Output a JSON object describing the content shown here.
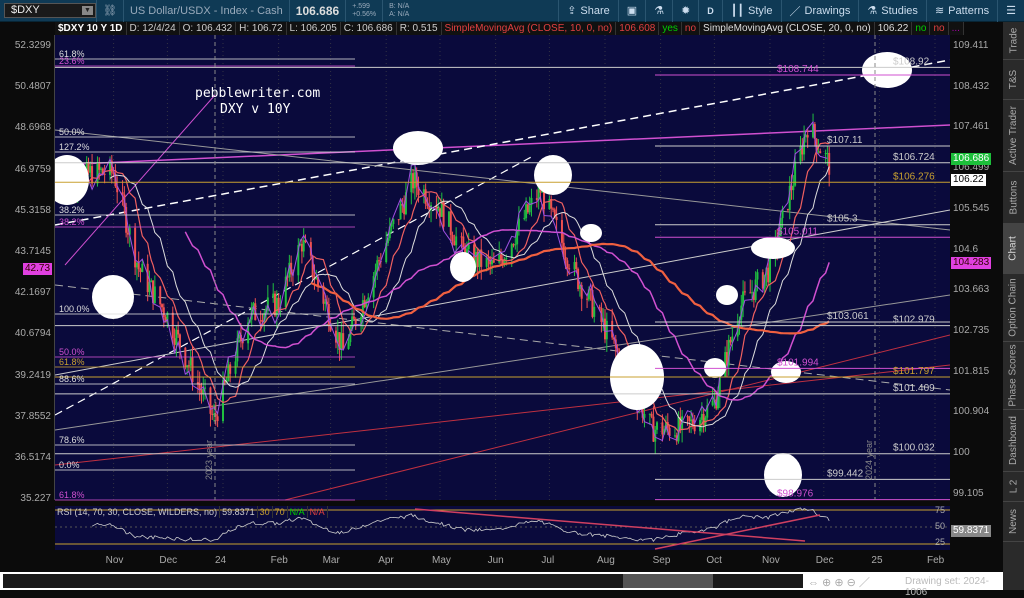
{
  "topbar": {
    "symbol": "$DXY",
    "description": "US Dollar/USDX - Index - Cash",
    "last": "106.686",
    "change": "+.599",
    "change_pct": "+0.56%",
    "bid": "B: N/A",
    "ask": "A: N/A",
    "buttons": [
      {
        "label": "Share",
        "icon": "share-icon"
      },
      {
        "label": "",
        "icon": "screenshot-icon"
      },
      {
        "label": "",
        "icon": "flask-icon"
      },
      {
        "label": "",
        "icon": "gear-icon"
      },
      {
        "label": "D",
        "icon": ""
      },
      {
        "label": "Style",
        "icon": "candle-icon"
      },
      {
        "label": "Drawings",
        "icon": "pencil-icon"
      },
      {
        "label": "Studies",
        "icon": "flask-icon"
      },
      {
        "label": "Patterns",
        "icon": "patterns-icon"
      },
      {
        "label": "",
        "icon": "menu-icon"
      }
    ]
  },
  "infobar": {
    "title": "$DXY 10 Y 1D",
    "date": "D: 12/4/24",
    "open": "O: 106.432",
    "high": "H: 106.72",
    "low": "L: 106.205",
    "close": "C: 106.686",
    "range": "R: 0.515",
    "sma1": "SimpleMovingAvg (CLOSE, 10, 0, no)",
    "sma1_val": "106.608",
    "sma1_a": "yes",
    "sma1_b": "no",
    "sma2": "SimpleMovingAvg (CLOSE, 20, 0, no)",
    "sma2_val": "106.22",
    "sma2_a": "no",
    "sma2_b": "no",
    "more": "..."
  },
  "watermark": {
    "site": "pebblewriter.com",
    "subtitle": "DXY v 10Y"
  },
  "left_axis": [
    "52.3299",
    "50.4807",
    "48.6968",
    "46.9759",
    "45.3158",
    "43.7145",
    "42.1697",
    "40.6794",
    "39.2419",
    "37.8552",
    "36.5174",
    "35.227"
  ],
  "left_badge": "42.73",
  "right_axis": [
    "109.411",
    "108.432",
    "107.461",
    "106.499",
    "105.545",
    "104.6",
    "103.663",
    "102.735",
    "101.815",
    "100.904",
    "100",
    "99.105"
  ],
  "right_badges": {
    "last": "106.686",
    "sma20": "106.22",
    "tnx": "104.283"
  },
  "fib_labels": [
    {
      "t": "61.8%",
      "c": "#ddd"
    },
    {
      "t": "23.6%",
      "c": "#d050d0"
    },
    {
      "t": "50.0%",
      "c": "#ddd"
    },
    {
      "t": "127.2%",
      "c": "#ddd"
    },
    {
      "t": "38.2%",
      "c": "#ddd"
    },
    {
      "t": "38.2%",
      "c": "#d050d0"
    },
    {
      "t": "100.0%",
      "c": "#ddd"
    },
    {
      "t": "50.0%",
      "c": "#d050d0"
    },
    {
      "t": "61.8%",
      "c": "#c8a030"
    },
    {
      "t": "88.6%",
      "c": "#ddd"
    },
    {
      "t": "78.6%",
      "c": "#ddd"
    },
    {
      "t": "0.0%",
      "c": "#ddd"
    },
    {
      "t": "61.8%",
      "c": "#d050d0"
    }
  ],
  "levels": [
    {
      "label": "$108.92",
      "price": 108.92,
      "color": "#cccccc"
    },
    {
      "label": "$108.744",
      "price": 108.744,
      "color": "#d050d0"
    },
    {
      "label": "$107.11",
      "price": 107.11,
      "color": "#cccccc"
    },
    {
      "label": "$106.724",
      "price": 106.724,
      "color": "#cccccc"
    },
    {
      "label": "$106.276",
      "price": 106.276,
      "color": "#c8a030"
    },
    {
      "label": "$105.3",
      "price": 105.3,
      "color": "#cccccc"
    },
    {
      "label": "$105.011",
      "price": 105.011,
      "color": "#d050d0"
    },
    {
      "label": "$103.061",
      "price": 103.061,
      "color": "#cccccc"
    },
    {
      "label": "$102.979",
      "price": 102.979,
      "color": "#cccccc"
    },
    {
      "label": "$101.994",
      "price": 101.994,
      "color": "#d050d0"
    },
    {
      "label": "$101.797",
      "price": 101.797,
      "color": "#c8a030"
    },
    {
      "label": "$101.409",
      "price": 101.409,
      "color": "#cccccc"
    },
    {
      "label": "$100.032",
      "price": 100.032,
      "color": "#cccccc"
    },
    {
      "label": "$99.442",
      "price": 99.442,
      "color": "#cccccc"
    },
    {
      "label": "$98.976",
      "price": 98.976,
      "color": "#d050d0"
    }
  ],
  "year_labels": [
    "2023 year",
    "2024 year"
  ],
  "chart_data": {
    "type": "candlestick",
    "title": "$DXY 10 Y 1D",
    "ylim": [
      99.105,
      109.411
    ],
    "x": [
      "2023-10-01",
      "2023-10-20",
      "2023-11-01",
      "2023-11-15",
      "2023-12-01",
      "2023-12-27",
      "2024-01-15",
      "2024-02-01",
      "2024-02-14",
      "2024-03-08",
      "2024-04-01",
      "2024-04-16",
      "2024-05-01",
      "2024-05-15",
      "2024-06-01",
      "2024-06-26",
      "2024-07-15",
      "2024-08-05",
      "2024-08-27",
      "2024-09-15",
      "2024-10-01",
      "2024-10-15",
      "2024-11-01",
      "2024-11-22",
      "2024-12-04"
    ],
    "close": [
      106.2,
      106.5,
      106.5,
      104.3,
      103.2,
      100.8,
      103.2,
      103.5,
      104.9,
      102.4,
      104.9,
      106.3,
      105.7,
      104.6,
      104.3,
      106.1,
      104.2,
      102.6,
      100.6,
      100.6,
      101.2,
      103.4,
      104.3,
      107.6,
      106.686
    ],
    "rsi": {
      "label": "RSI (14, 70, 30, CLOSE, WILDERS, no)",
      "value": "59.8371",
      "ob": "30",
      "os": "70",
      "a": "N/A",
      "b": "N/A",
      "ticks": [
        "75",
        "50",
        "25"
      ]
    }
  },
  "xaxis": [
    "Nov",
    "Dec",
    "24",
    "Feb",
    "Mar",
    "Apr",
    "May",
    "Jun",
    "Jul",
    "Aug",
    "Sep",
    "Oct",
    "Nov",
    "Dec",
    "25",
    "Feb"
  ],
  "sidetabs": [
    "Trade",
    "T&S",
    "Active Trader",
    "Buttons",
    "Chart",
    "Option Chain",
    "Phase Scores",
    "Dashboard",
    "L 2",
    "News"
  ],
  "footer": {
    "drawing_set": "Drawing set: 2024-1006"
  }
}
